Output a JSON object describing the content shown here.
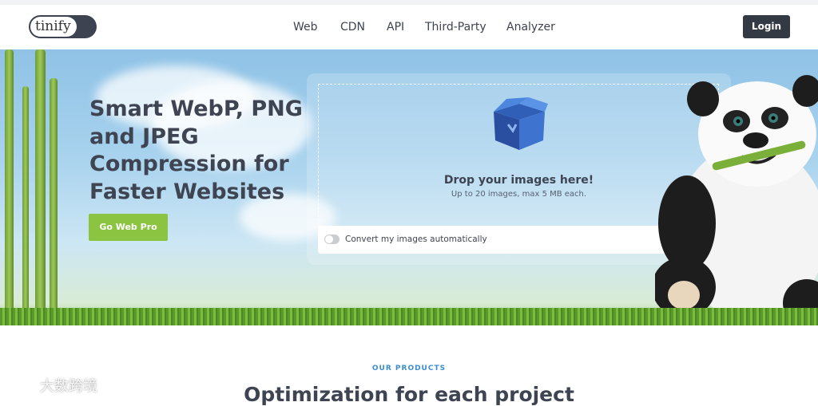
{
  "header": {
    "logo_text": "tinify",
    "nav": [
      "Web",
      "CDN",
      "API",
      "Third-Party",
      "Analyzer"
    ],
    "login_label": "Login"
  },
  "hero": {
    "title": "Smart WebP, PNG and JPEG Compression for Faster Websites",
    "cta_label": "Go Web Pro",
    "drop_title": "Drop your images here!",
    "drop_sub": "Up to 20 images, max 5 MB each.",
    "convert_label": "Convert my images automatically",
    "convert_enabled": false
  },
  "section": {
    "eyebrow": "OUR PRODUCTS",
    "heading": "Optimization for each project"
  },
  "watermark": "大数跨境",
  "icons": [
    "box-icon",
    "panda-mascot",
    "bamboo-decoration",
    "watermark-logo-icon"
  ]
}
